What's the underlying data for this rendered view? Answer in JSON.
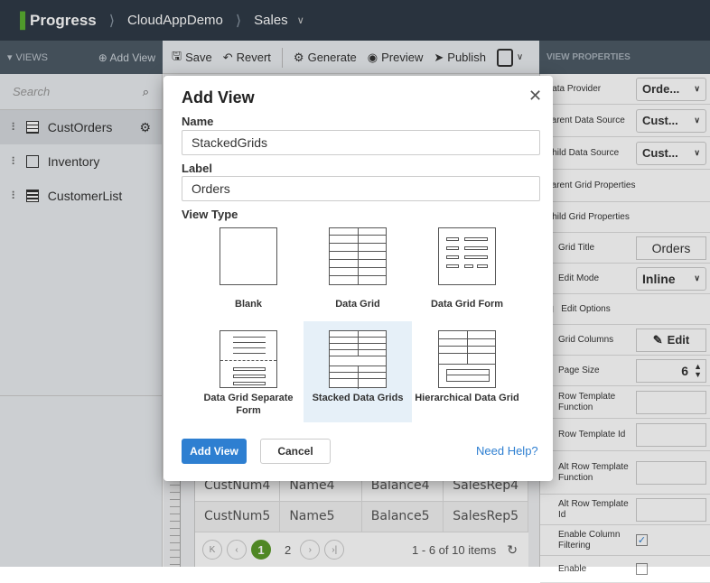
{
  "topbar": {
    "logo": "Progress",
    "project": "CloudAppDemo",
    "module": "Sales"
  },
  "views_bar": {
    "title": "VIEWS",
    "add_label": "Add View"
  },
  "toolbar": {
    "save": "Save",
    "revert": "Revert",
    "generate": "Generate",
    "preview": "Preview",
    "publish": "Publish",
    "view_properties": "VIEW PROPERTIES"
  },
  "left_panel": {
    "search_placeholder": "Search",
    "items": [
      {
        "label": "CustOrders"
      },
      {
        "label": "Inventory"
      },
      {
        "label": "CustomerList"
      }
    ]
  },
  "grid": {
    "rows": [
      [
        "CustNum4",
        "Name4",
        "Balance4",
        "SalesRep4"
      ],
      [
        "CustNum5",
        "Name5",
        "Balance5",
        "SalesRep5"
      ]
    ],
    "pager": {
      "current_page": "1",
      "next_page": "2",
      "info": "1 - 6 of 10 items"
    }
  },
  "properties": {
    "data_provider": {
      "label": "Data Provider",
      "value": "Orde..."
    },
    "parent_source": {
      "label": "Parent Data Source",
      "value": "Cust..."
    },
    "child_source": {
      "label": "Child Data Source",
      "value": "Cust..."
    },
    "parent_grid": {
      "label": "Parent Grid Properties"
    },
    "child_grid": {
      "label": "Child Grid Properties"
    },
    "grid_title": {
      "label": "Grid Title",
      "value": "Orders"
    },
    "edit_mode": {
      "label": "Edit Mode",
      "value": "Inline"
    },
    "edit_options": {
      "label": "Edit Options"
    },
    "grid_columns": {
      "label": "Grid Columns",
      "button": "Edit"
    },
    "page_size": {
      "label": "Page Size",
      "value": "6"
    },
    "row_template_function": {
      "label": "Row Template Function"
    },
    "row_template_id": {
      "label": "Row Template Id"
    },
    "alt_row_template_function": {
      "label": "Alt Row Template Function"
    },
    "alt_row_template_id": {
      "label": "Alt Row Template Id"
    },
    "enable_column_filtering": {
      "label": "Enable Column Filtering",
      "checked": true
    },
    "enable": {
      "label": "Enable"
    }
  },
  "dialog": {
    "title": "Add View",
    "name_label": "Name",
    "name_value": "StackedGrids",
    "label_label": "Label",
    "label_value": "Orders",
    "view_type_label": "View Type",
    "view_types": [
      {
        "label": "Blank"
      },
      {
        "label": "Data Grid"
      },
      {
        "label": "Data Grid Form"
      },
      {
        "label": "Data Grid Separate Form"
      },
      {
        "label": "Stacked Data Grids",
        "selected": true
      },
      {
        "label": "Hierarchical Data Grid"
      }
    ],
    "add_button": "Add View",
    "cancel_button": "Cancel",
    "help_link": "Need Help?"
  }
}
